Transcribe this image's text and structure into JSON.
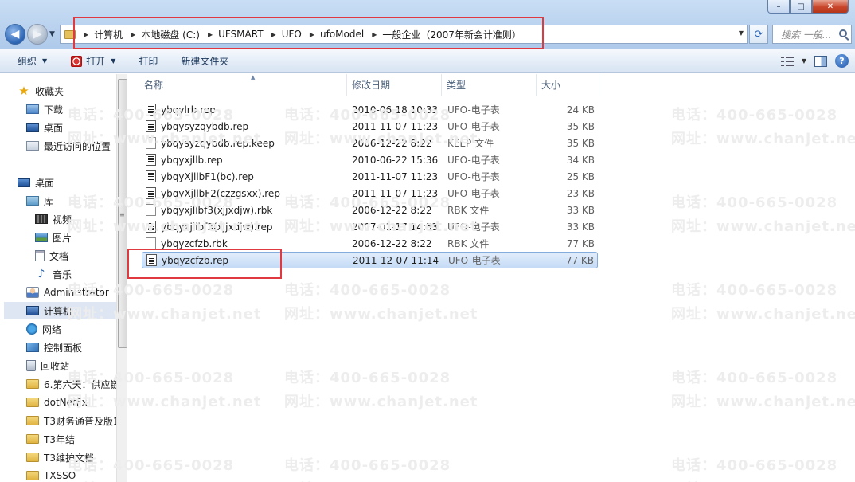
{
  "window": {
    "controls": [
      "–",
      "□",
      "✕"
    ]
  },
  "address": {
    "crumbs": [
      "计算机",
      "本地磁盘 (C:)",
      "UFSMART",
      "UFO",
      "ufoModel",
      "一般企业（2007年新会计准则）"
    ],
    "search_placeholder": "搜索 一般..."
  },
  "toolbar": {
    "organize": "组织",
    "open": "打开",
    "print": "打印",
    "new_folder": "新建文件夹"
  },
  "nav": {
    "favorites_label": "收藏夹",
    "favorites": [
      "下载",
      "桌面",
      "最近访问的位置"
    ],
    "desktop_label": "桌面",
    "library_label": "库",
    "libraries": [
      "视频",
      "图片",
      "文档",
      "音乐"
    ],
    "user": "Administrator",
    "computer": "计算机",
    "network": "网络",
    "control_panel": "控制面板",
    "recycle_bin": "回收站",
    "folders": [
      "6.第六天：供应链",
      "dotNetFx",
      "T3财务通普及版1",
      "T3年结",
      "T3维护文档",
      "TXSSO"
    ]
  },
  "columns": {
    "name": "名称",
    "date": "修改日期",
    "type": "类型",
    "size": "大小"
  },
  "files": [
    {
      "name": "ybqylrb.rep",
      "date": "2010-06-18 10:33",
      "type": "UFO-电子表",
      "size": "24 KB",
      "icon": "ufo-file-icon"
    },
    {
      "name": "ybqysyzqybdb.rep",
      "date": "2011-11-07 11:23",
      "type": "UFO-电子表",
      "size": "35 KB",
      "icon": "ufo-file-icon"
    },
    {
      "name": "ybqysyzqybdb.rep.keep",
      "date": "2006-12-22 8:22",
      "type": "KEEP 文件",
      "size": "35 KB",
      "icon": "generic-file-icon"
    },
    {
      "name": "ybqyxjllb.rep",
      "date": "2010-06-22 15:36",
      "type": "UFO-电子表",
      "size": "34 KB",
      "icon": "ufo-file-icon"
    },
    {
      "name": "ybqyXjllbF1(bc).rep",
      "date": "2011-11-07 11:23",
      "type": "UFO-电子表",
      "size": "25 KB",
      "icon": "ufo-file-icon"
    },
    {
      "name": "ybqyXjllbF2(czzgsxx).rep",
      "date": "2011-11-07 11:23",
      "type": "UFO-电子表",
      "size": "23 KB",
      "icon": "ufo-file-icon"
    },
    {
      "name": "ybqyxjllbf3(xjjxdjw).rbk",
      "date": "2006-12-22 8:22",
      "type": "RBK 文件",
      "size": "33 KB",
      "icon": "generic-file-icon"
    },
    {
      "name": "ybqyxjllbf3(xjjxdjw).rep",
      "date": "2007-01-17 14:53",
      "type": "UFO-电子表",
      "size": "33 KB",
      "icon": "ufo-file-icon"
    },
    {
      "name": "ybqyzcfzb.rbk",
      "date": "2006-12-22 8:22",
      "type": "RBK 文件",
      "size": "77 KB",
      "icon": "generic-file-icon"
    },
    {
      "name": "ybqyzcfzb.rep",
      "date": "2011-12-07 11:14",
      "type": "UFO-电子表",
      "size": "77 KB",
      "icon": "ufo-file-icon",
      "selected": true
    }
  ],
  "watermark": {
    "phone": "电话：400-665-0028",
    "site": "网址：www.chanjet.net"
  },
  "colors": {
    "highlight_box": "#e0393f",
    "selection": "#c4dbf6"
  }
}
